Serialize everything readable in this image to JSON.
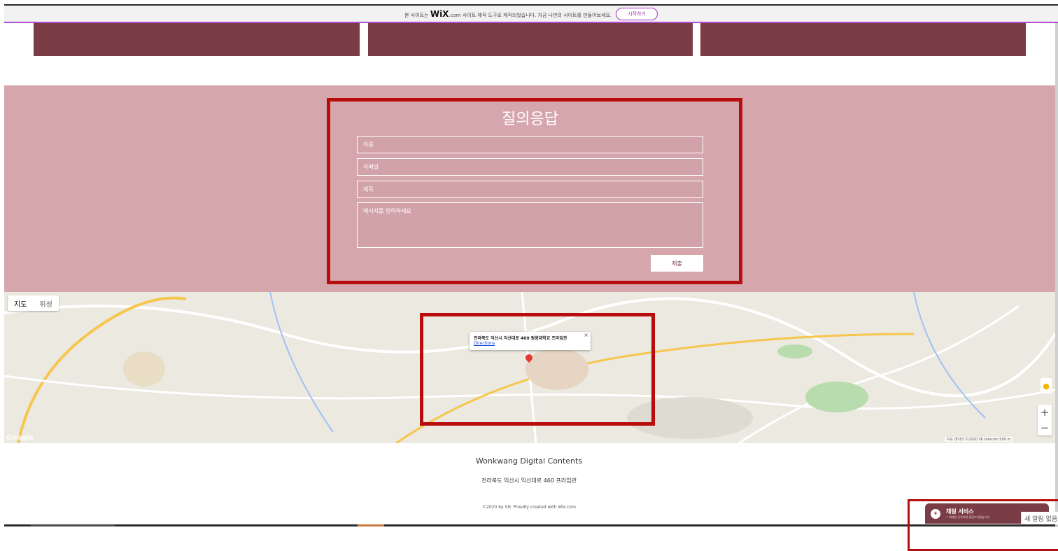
{
  "banner": {
    "text_before": "본 사이트는",
    "brand": "WiX",
    "text_after": ".com 사이트 제작 도구로 제작되었습니다. 지금 나만의 사이트를 만들어보세요.",
    "start_label": "시작하기"
  },
  "contact": {
    "title": "질의응답",
    "fields": {
      "name_placeholder": "이름",
      "email_placeholder": "이메일",
      "subject_placeholder": "제목",
      "message_placeholder": "메시지를 입력하세요"
    },
    "submit_label": "제출"
  },
  "map": {
    "type_map": "지도",
    "type_satellite": "위성",
    "info_address": "전라북도 익산시 익산대로 460 원광대학교 프라임관",
    "info_link": "Directions",
    "close": "×",
    "zoom_in": "+",
    "zoom_out": "−",
    "google": "Google",
    "attribution": "지도 데이터 ©2020 SK telecom   500 m"
  },
  "footer": {
    "name": "Wonkwang Digital Contents",
    "address": "전라북도 익산시 익산대로 460 프라임관",
    "copyright": "©2020 by SH. Proudly created with Wix.com"
  },
  "chat": {
    "title": "채팅 서비스",
    "subtitle": "⚡ 최대한 신속하게 응답드리겠습니다.",
    "toast": "새 알림 없음"
  },
  "colors": {
    "card": "#7b3d45",
    "contact_bg": "#d6a6ad",
    "highlight": "#b80d0d",
    "wix_accent": "#a23bbd"
  }
}
